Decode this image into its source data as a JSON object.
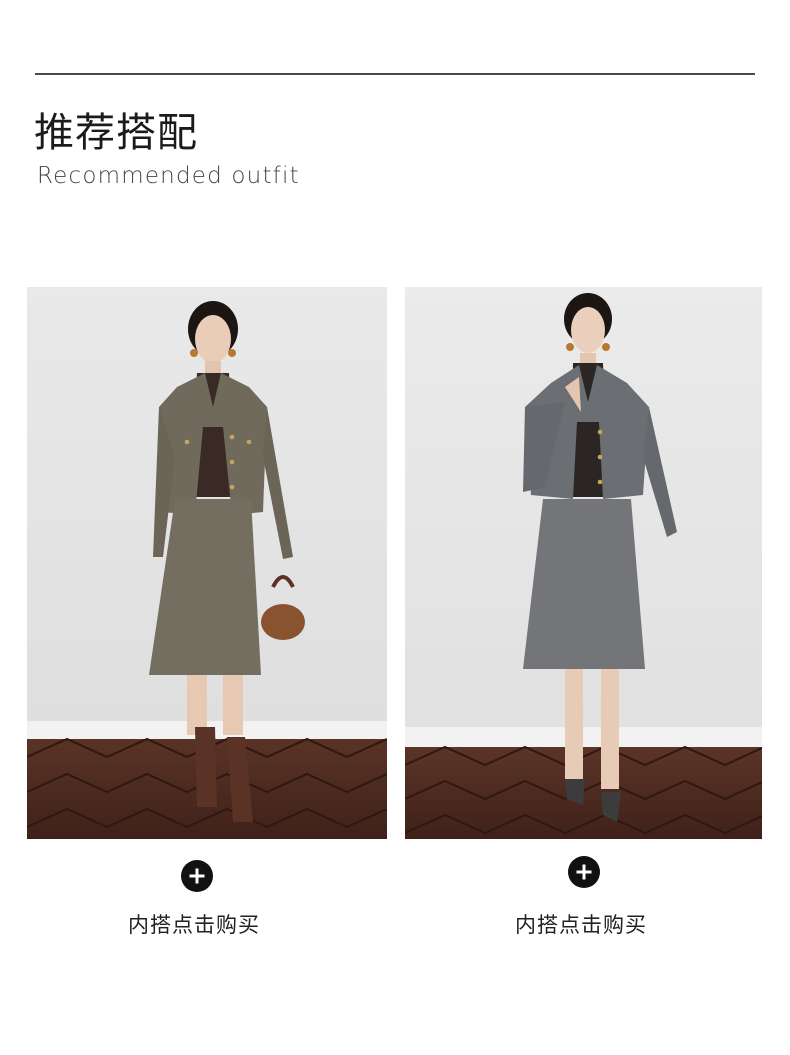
{
  "header": {
    "title_cn": "推荐搭配",
    "title_en": "Recommended outfit"
  },
  "outfits": [
    {
      "photo_alt": "Model in olive-brown wool cropped jacket and midi skirt with brown bag and boots",
      "plus_icon": "plus-circle-icon",
      "buy_label": "内搭点击购买",
      "colors": {
        "jacket": "#6f6a5c",
        "turtleneck": "#3a2a25"
      }
    },
    {
      "photo_alt": "Model in grey wool cropped jacket and midi skirt with slingback heels",
      "plus_icon": "plus-circle-icon",
      "buy_label": "内搭点击购买",
      "colors": {
        "jacket": "#6b6e72",
        "turtleneck": "#2b2523"
      }
    }
  ],
  "colors": {
    "accent": "#111111",
    "text": "#1b1b1b"
  }
}
